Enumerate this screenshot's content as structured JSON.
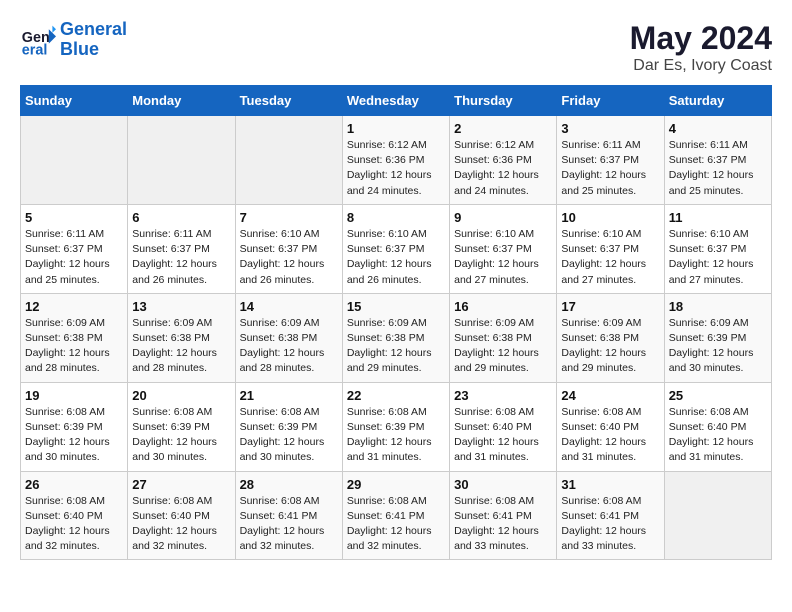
{
  "header": {
    "logo_line1": "General",
    "logo_line2": "Blue",
    "month_year": "May 2024",
    "location": "Dar Es, Ivory Coast"
  },
  "days_of_week": [
    "Sunday",
    "Monday",
    "Tuesday",
    "Wednesday",
    "Thursday",
    "Friday",
    "Saturday"
  ],
  "weeks": [
    [
      {
        "num": "",
        "info": ""
      },
      {
        "num": "",
        "info": ""
      },
      {
        "num": "",
        "info": ""
      },
      {
        "num": "1",
        "info": "Sunrise: 6:12 AM\nSunset: 6:36 PM\nDaylight: 12 hours\nand 24 minutes."
      },
      {
        "num": "2",
        "info": "Sunrise: 6:12 AM\nSunset: 6:36 PM\nDaylight: 12 hours\nand 24 minutes."
      },
      {
        "num": "3",
        "info": "Sunrise: 6:11 AM\nSunset: 6:37 PM\nDaylight: 12 hours\nand 25 minutes."
      },
      {
        "num": "4",
        "info": "Sunrise: 6:11 AM\nSunset: 6:37 PM\nDaylight: 12 hours\nand 25 minutes."
      }
    ],
    [
      {
        "num": "5",
        "info": "Sunrise: 6:11 AM\nSunset: 6:37 PM\nDaylight: 12 hours\nand 25 minutes."
      },
      {
        "num": "6",
        "info": "Sunrise: 6:11 AM\nSunset: 6:37 PM\nDaylight: 12 hours\nand 26 minutes."
      },
      {
        "num": "7",
        "info": "Sunrise: 6:10 AM\nSunset: 6:37 PM\nDaylight: 12 hours\nand 26 minutes."
      },
      {
        "num": "8",
        "info": "Sunrise: 6:10 AM\nSunset: 6:37 PM\nDaylight: 12 hours\nand 26 minutes."
      },
      {
        "num": "9",
        "info": "Sunrise: 6:10 AM\nSunset: 6:37 PM\nDaylight: 12 hours\nand 27 minutes."
      },
      {
        "num": "10",
        "info": "Sunrise: 6:10 AM\nSunset: 6:37 PM\nDaylight: 12 hours\nand 27 minutes."
      },
      {
        "num": "11",
        "info": "Sunrise: 6:10 AM\nSunset: 6:37 PM\nDaylight: 12 hours\nand 27 minutes."
      }
    ],
    [
      {
        "num": "12",
        "info": "Sunrise: 6:09 AM\nSunset: 6:38 PM\nDaylight: 12 hours\nand 28 minutes."
      },
      {
        "num": "13",
        "info": "Sunrise: 6:09 AM\nSunset: 6:38 PM\nDaylight: 12 hours\nand 28 minutes."
      },
      {
        "num": "14",
        "info": "Sunrise: 6:09 AM\nSunset: 6:38 PM\nDaylight: 12 hours\nand 28 minutes."
      },
      {
        "num": "15",
        "info": "Sunrise: 6:09 AM\nSunset: 6:38 PM\nDaylight: 12 hours\nand 29 minutes."
      },
      {
        "num": "16",
        "info": "Sunrise: 6:09 AM\nSunset: 6:38 PM\nDaylight: 12 hours\nand 29 minutes."
      },
      {
        "num": "17",
        "info": "Sunrise: 6:09 AM\nSunset: 6:38 PM\nDaylight: 12 hours\nand 29 minutes."
      },
      {
        "num": "18",
        "info": "Sunrise: 6:09 AM\nSunset: 6:39 PM\nDaylight: 12 hours\nand 30 minutes."
      }
    ],
    [
      {
        "num": "19",
        "info": "Sunrise: 6:08 AM\nSunset: 6:39 PM\nDaylight: 12 hours\nand 30 minutes."
      },
      {
        "num": "20",
        "info": "Sunrise: 6:08 AM\nSunset: 6:39 PM\nDaylight: 12 hours\nand 30 minutes."
      },
      {
        "num": "21",
        "info": "Sunrise: 6:08 AM\nSunset: 6:39 PM\nDaylight: 12 hours\nand 30 minutes."
      },
      {
        "num": "22",
        "info": "Sunrise: 6:08 AM\nSunset: 6:39 PM\nDaylight: 12 hours\nand 31 minutes."
      },
      {
        "num": "23",
        "info": "Sunrise: 6:08 AM\nSunset: 6:40 PM\nDaylight: 12 hours\nand 31 minutes."
      },
      {
        "num": "24",
        "info": "Sunrise: 6:08 AM\nSunset: 6:40 PM\nDaylight: 12 hours\nand 31 minutes."
      },
      {
        "num": "25",
        "info": "Sunrise: 6:08 AM\nSunset: 6:40 PM\nDaylight: 12 hours\nand 31 minutes."
      }
    ],
    [
      {
        "num": "26",
        "info": "Sunrise: 6:08 AM\nSunset: 6:40 PM\nDaylight: 12 hours\nand 32 minutes."
      },
      {
        "num": "27",
        "info": "Sunrise: 6:08 AM\nSunset: 6:40 PM\nDaylight: 12 hours\nand 32 minutes."
      },
      {
        "num": "28",
        "info": "Sunrise: 6:08 AM\nSunset: 6:41 PM\nDaylight: 12 hours\nand 32 minutes."
      },
      {
        "num": "29",
        "info": "Sunrise: 6:08 AM\nSunset: 6:41 PM\nDaylight: 12 hours\nand 32 minutes."
      },
      {
        "num": "30",
        "info": "Sunrise: 6:08 AM\nSunset: 6:41 PM\nDaylight: 12 hours\nand 33 minutes."
      },
      {
        "num": "31",
        "info": "Sunrise: 6:08 AM\nSunset: 6:41 PM\nDaylight: 12 hours\nand 33 minutes."
      },
      {
        "num": "",
        "info": ""
      }
    ]
  ]
}
